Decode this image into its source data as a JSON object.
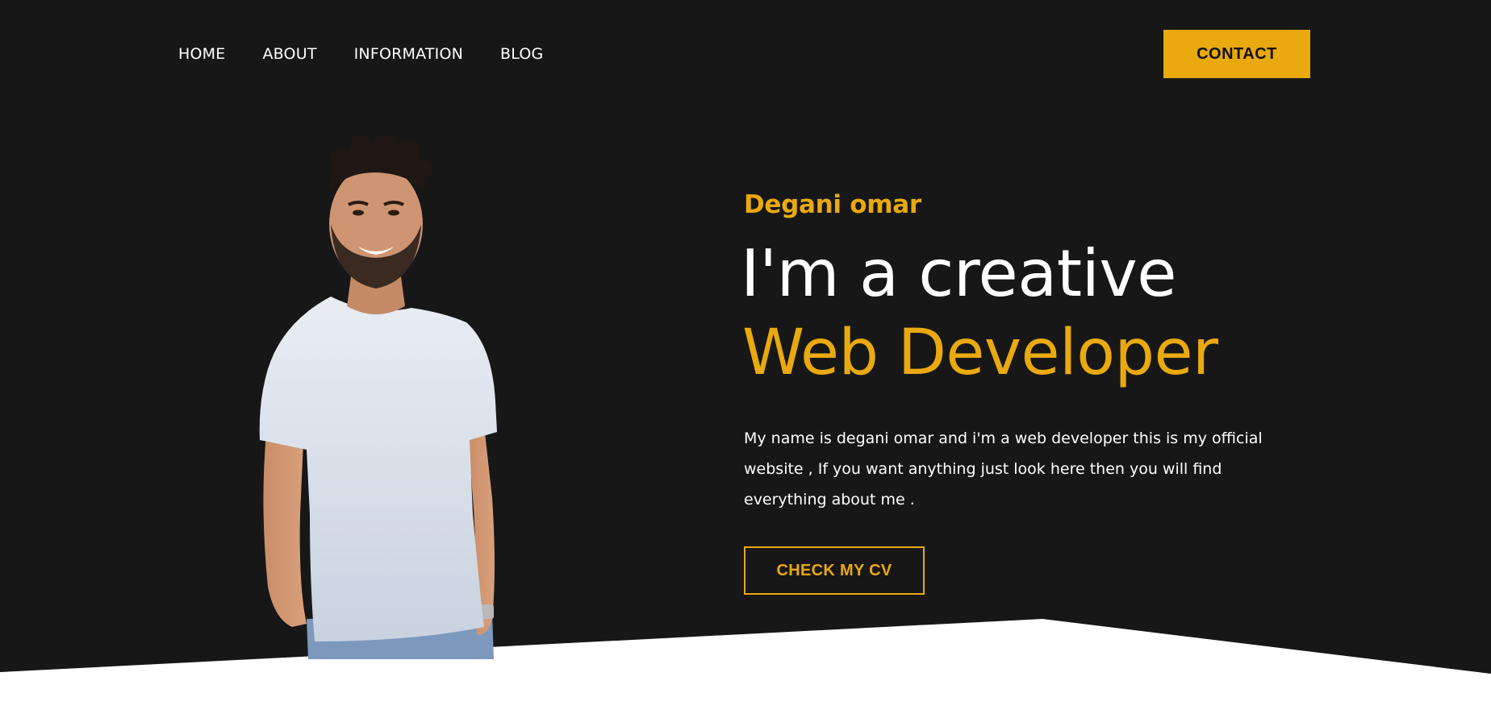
{
  "nav": {
    "items": [
      {
        "label": "HOME"
      },
      {
        "label": "ABOUT"
      },
      {
        "label": "INFORMATION"
      },
      {
        "label": "BLOG"
      }
    ],
    "contact_label": "CONTACT"
  },
  "hero": {
    "name": "Degani omar",
    "headline_line1": "I'm a creative",
    "headline_line2": "Web Developer",
    "intro_line1": "My name is degani omar and i'm a web developer this is my official",
    "intro_line2": "website , If you want anything just look here then you will find",
    "intro_line3": "everything about me .",
    "cv_label": "CHECK MY CV"
  },
  "colors": {
    "background": "#171717",
    "accent": "#e9a90f",
    "text": "#ffffff"
  },
  "icons": {
    "portrait": "person-photo"
  }
}
